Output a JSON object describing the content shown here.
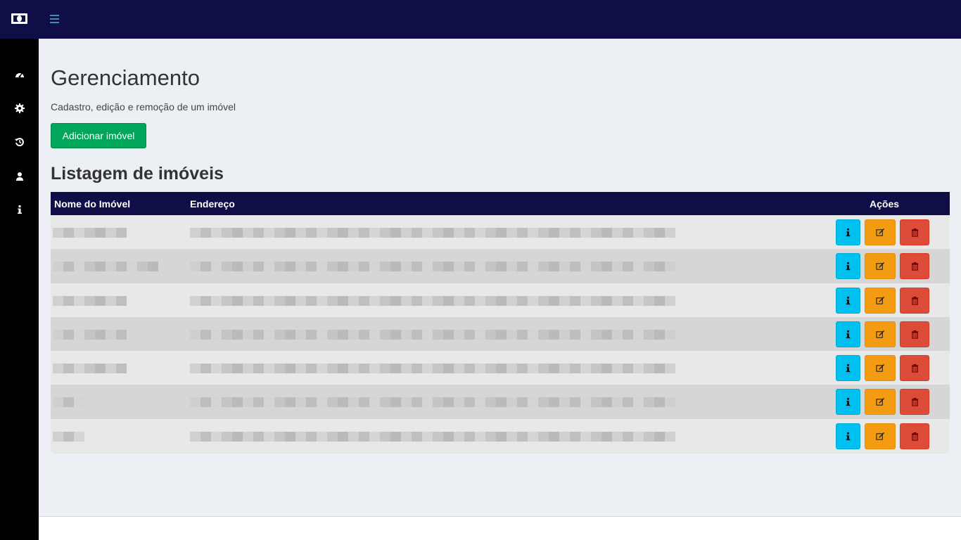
{
  "topbar": {
    "brand_icon": "money-bill-icon",
    "menu_icon": "bars-icon",
    "bg_color": "#0f0e47"
  },
  "sidebar": {
    "items": [
      {
        "name": "dashboard",
        "icon": "tachometer-icon"
      },
      {
        "name": "settings",
        "icon": "gear-icon"
      },
      {
        "name": "history",
        "icon": "history-icon"
      },
      {
        "name": "user",
        "icon": "user-icon"
      },
      {
        "name": "info",
        "icon": "info-icon"
      }
    ]
  },
  "page": {
    "title": "Gerenciamento",
    "subtitle": "Cadastro, edição e remoção de um imóvel",
    "add_button": "Adicionar imóvel",
    "list_title": "Listagem de imóveis"
  },
  "table": {
    "headers": {
      "name": "Nome do Imóvel",
      "address": "Endereço",
      "actions": "Ações"
    },
    "rows": [
      {
        "name": "",
        "address": ""
      },
      {
        "name": "",
        "address": ""
      },
      {
        "name": "",
        "address": ""
      },
      {
        "name": "",
        "address": ""
      },
      {
        "name": "",
        "address": ""
      },
      {
        "name": "",
        "address": ""
      },
      {
        "name": "",
        "address": ""
      }
    ],
    "row_action_icons": [
      "info-icon",
      "edit-icon",
      "trash-icon"
    ]
  },
  "colors": {
    "success": "#00a65a",
    "info": "#00c0ef",
    "warning": "#f39c12",
    "danger": "#dd4b39",
    "header": "#0f0e47"
  }
}
